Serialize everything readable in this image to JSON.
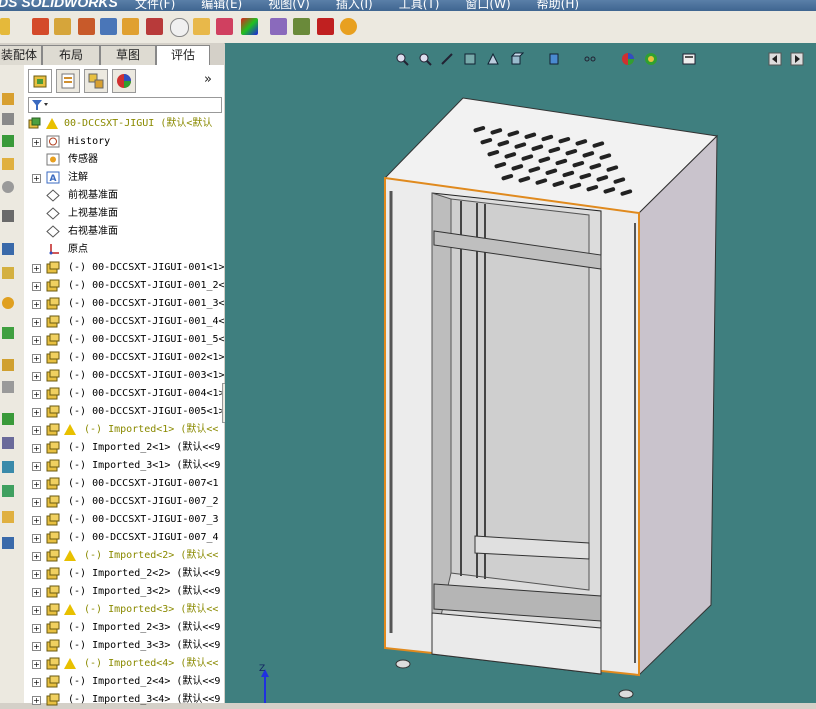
{
  "app": {
    "logo": "DS SOLIDWORKS",
    "menus": [
      "文件(F)",
      "编辑(E)",
      "视图(V)",
      "插入(I)",
      "工具(T)",
      "窗口(W)",
      "帮助(H)"
    ]
  },
  "command_tabs": [
    "装配体",
    "布局",
    "草图",
    "评估"
  ],
  "active_tab": "评估",
  "tree": {
    "root": "00-DCCSXT-JIGUI (默认<默认",
    "history": "History",
    "sensors": "传感器",
    "annotations": "注解",
    "front_plane": "前视基准面",
    "top_plane": "上视基准面",
    "right_plane": "右视基准面",
    "origin": "原点",
    "components": [
      {
        "label": "(-) 00-DCCSXT-JIGUI-001<1>",
        "warn": false
      },
      {
        "label": "(-) 00-DCCSXT-JIGUI-001_2<",
        "warn": false
      },
      {
        "label": "(-) 00-DCCSXT-JIGUI-001_3<",
        "warn": false
      },
      {
        "label": "(-) 00-DCCSXT-JIGUI-001_4<",
        "warn": false
      },
      {
        "label": "(-) 00-DCCSXT-JIGUI-001_5<",
        "warn": false
      },
      {
        "label": "(-) 00-DCCSXT-JIGUI-002<1>",
        "warn": false
      },
      {
        "label": "(-) 00-DCCSXT-JIGUI-003<1>",
        "warn": false
      },
      {
        "label": "(-) 00-DCCSXT-JIGUI-004<1>",
        "warn": false
      },
      {
        "label": "(-) 00-DCCSXT-JIGUI-005<1>",
        "warn": false
      },
      {
        "label": "(-) Imported<1> (默认<<",
        "warn": true
      },
      {
        "label": "(-) Imported_2<1> (默认<<9",
        "warn": false
      },
      {
        "label": "(-) Imported_3<1> (默认<<9",
        "warn": false
      },
      {
        "label": "(-) 00-DCCSXT-JIGUI-007<1",
        "warn": false
      },
      {
        "label": "(-) 00-DCCSXT-JIGUI-007_2",
        "warn": false
      },
      {
        "label": "(-) 00-DCCSXT-JIGUI-007_3",
        "warn": false
      },
      {
        "label": "(-) 00-DCCSXT-JIGUI-007_4",
        "warn": false
      },
      {
        "label": "(-) Imported<2> (默认<<",
        "warn": true
      },
      {
        "label": "(-) Imported_2<2> (默认<<9",
        "warn": false
      },
      {
        "label": "(-) Imported_3<2> (默认<<9",
        "warn": false
      },
      {
        "label": "(-) Imported<3> (默认<<",
        "warn": true
      },
      {
        "label": "(-) Imported_2<3> (默认<<9",
        "warn": false
      },
      {
        "label": "(-) Imported_3<3> (默认<<9",
        "warn": false
      },
      {
        "label": "(-) Imported<4> (默认<<",
        "warn": true
      },
      {
        "label": "(-) Imported_2<4> (默认<<9",
        "warn": false
      },
      {
        "label": "(-) Imported_3<4> (默认<<9",
        "warn": false
      }
    ]
  },
  "triad_label": "Z",
  "colors": {
    "viewport": "#3f7f7f",
    "warning": "#e8c000",
    "edge_highlight": "#e08a1e"
  }
}
